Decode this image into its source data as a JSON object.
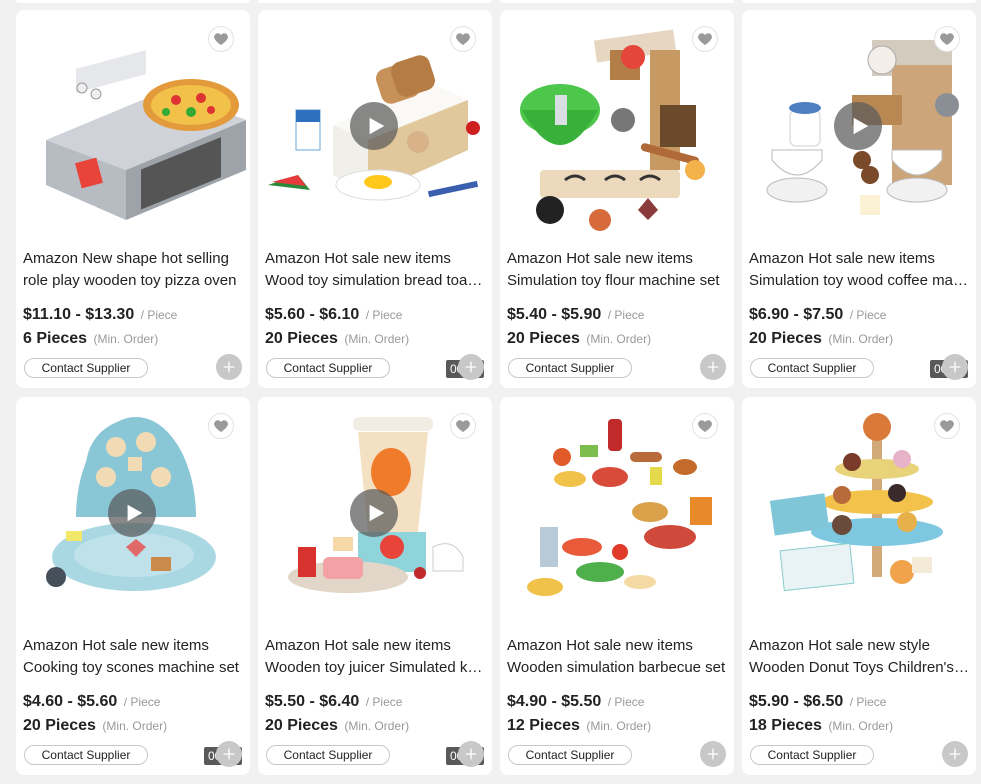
{
  "ui": {
    "contact_label": "Contact Supplier",
    "unit_label": "/ Piece",
    "moq_label": "(Min. Order)"
  },
  "products": [
    {
      "title_line1": "Amazon New shape hot selling",
      "title_line2": "role play wooden toy pizza oven",
      "price": "$11.10 - $13.30",
      "moq": "6 Pieces",
      "has_video": false,
      "duration": "",
      "image": "toy-pizza-oven"
    },
    {
      "title_line1": "Amazon Hot sale new items",
      "title_line2": "Wood toy simulation bread toaster",
      "price": "$5.60 - $6.10",
      "moq": "20 Pieces",
      "has_video": true,
      "duration": "00:22",
      "image": "toy-toaster"
    },
    {
      "title_line1": "Amazon Hot sale new items",
      "title_line2": "Simulation toy flour machine set",
      "price": "$5.40 - $5.90",
      "moq": "20 Pieces",
      "has_video": false,
      "duration": "",
      "image": "toy-mixer"
    },
    {
      "title_line1": "Amazon Hot sale new items",
      "title_line2": "Simulation toy wood coffee machine",
      "price": "$6.90 - $7.50",
      "moq": "20 Pieces",
      "has_video": true,
      "duration": "00:29",
      "image": "toy-coffee-machine"
    },
    {
      "title_line1": "Amazon Hot sale new items",
      "title_line2": "Cooking toy scones machine set",
      "price": "$4.60 - $5.60",
      "moq": "20 Pieces",
      "has_video": true,
      "duration": "00:33",
      "image": "toy-scones-machine"
    },
    {
      "title_line1": "Amazon Hot sale new items",
      "title_line2": "Wooden toy juicer Simulated kitchen",
      "price": "$5.50 - $6.40",
      "moq": "20 Pieces",
      "has_video": true,
      "duration": "00:35",
      "image": "toy-juicer"
    },
    {
      "title_line1": "Amazon Hot sale new items",
      "title_line2": "Wooden simulation barbecue set",
      "price": "$4.90 - $5.50",
      "moq": "12 Pieces",
      "has_video": false,
      "duration": "",
      "image": "toy-barbecue"
    },
    {
      "title_line1": "Amazon Hot sale new style",
      "title_line2": "Wooden Donut Toys Children's set",
      "price": "$5.90 - $6.50",
      "moq": "18 Pieces",
      "has_video": false,
      "duration": "",
      "image": "toy-donut-stand"
    }
  ],
  "colors": {
    "page_bg": "#f1f1f1",
    "card_bg": "#ffffff",
    "text": "#222222",
    "muted": "#999999",
    "button_gray": "#c8c8c8"
  }
}
